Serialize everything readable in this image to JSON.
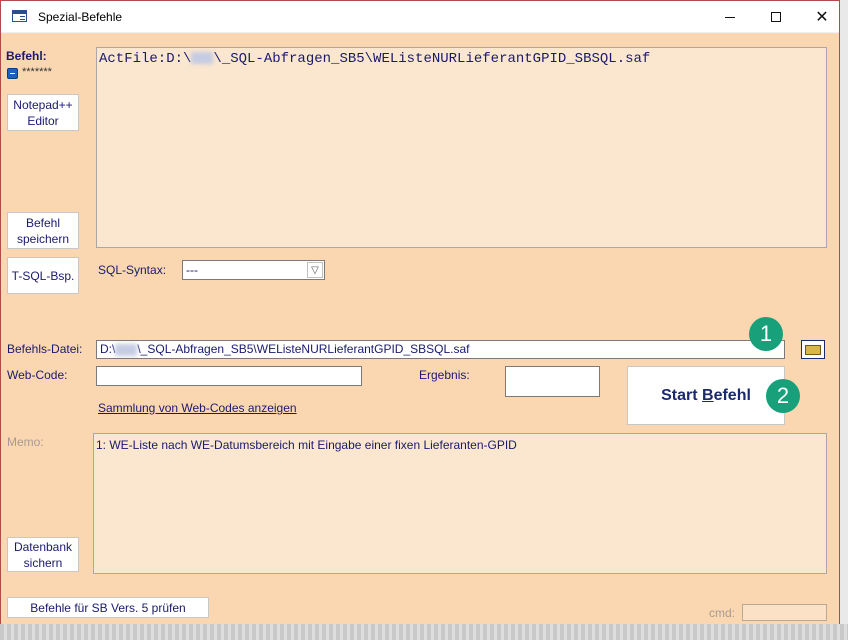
{
  "window": {
    "title": "Spezial-Befehle"
  },
  "left": {
    "befehl_label": "Befehl:",
    "password_mask": "*******",
    "notepad_button": "Notepad++ Editor",
    "save_button": "Befehl speichern",
    "tsql_button": "T-SQL-Bsp.",
    "backup_button": "Datenbank sichern",
    "check_button": "Befehle für SB Vers. 5 prüfen"
  },
  "command": {
    "text_prefix": "ActFile:D:\\",
    "text_suffix": "\\_SQL-Abfragen_SB5\\WEListeNURLieferantGPID_SBSQL.saf"
  },
  "sql_syntax": {
    "label": "SQL-Syntax:",
    "value": "---"
  },
  "file": {
    "label": "Befehls-Datei:",
    "value_prefix": "D:\\",
    "value_suffix": "\\_SQL-Abfragen_SB5\\WEListeNURLieferantGPID_SBSQL.saf"
  },
  "webcode": {
    "label": "Web-Code:",
    "value": "",
    "link": "Sammlung von Web-Codes anzeigen"
  },
  "ergebnis": {
    "label": "Ergebnis:",
    "value": ""
  },
  "start_button": {
    "prefix": "Start ",
    "underlined": "B",
    "suffix": "efehl"
  },
  "memo": {
    "label": "Memo:",
    "text": "1: WE-Liste nach WE-Datumsbereich mit Eingabe einer fixen Lieferanten-GPID"
  },
  "cmd": {
    "label": "cmd:",
    "value": ""
  },
  "badges": {
    "one": "1",
    "two": "2"
  },
  "colors": {
    "background": "#fbd7b1",
    "text": "#1a1a6e",
    "badge": "#17a07a"
  }
}
